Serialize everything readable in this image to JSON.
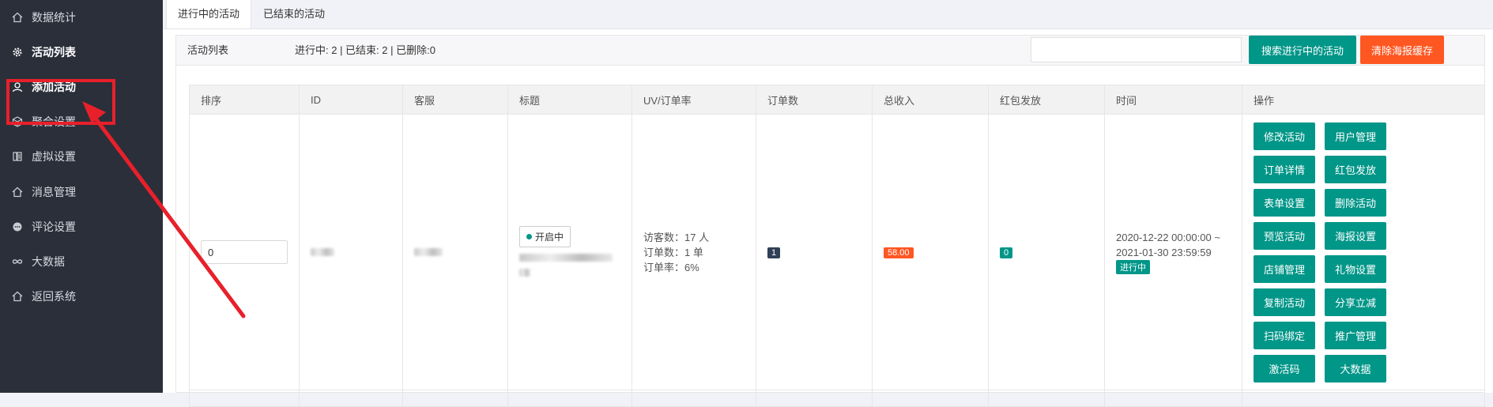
{
  "sidebar": {
    "items": [
      {
        "label": "数据统计",
        "icon": "home-icon"
      },
      {
        "label": "活动列表",
        "icon": "gear-icon"
      },
      {
        "label": "添加活动",
        "icon": "user-icon"
      },
      {
        "label": "聚合设置",
        "icon": "cube-icon"
      },
      {
        "label": "虚拟设置",
        "icon": "book-icon"
      },
      {
        "label": "消息管理",
        "icon": "home-icon"
      },
      {
        "label": "评论设置",
        "icon": "chat-icon"
      },
      {
        "label": "大数据",
        "icon": "infinity-icon"
      },
      {
        "label": "返回系统",
        "icon": "home-icon"
      }
    ]
  },
  "tabs": [
    {
      "label": "进行中的活动"
    },
    {
      "label": "已结束的活动"
    }
  ],
  "panel": {
    "title": "活动列表",
    "stats": "进行中: 2 | 已结束: 2 | 已删除:0",
    "search_button": "搜索进行中的活动",
    "clear_button": "清除海报缓存"
  },
  "table": {
    "headers": [
      "排序",
      "ID",
      "客服",
      "标题",
      "UV/订单率",
      "订单数",
      "总收入",
      "红包发放",
      "时间",
      "操作"
    ],
    "row": {
      "sort_value": "0",
      "status": "开启中",
      "uv": [
        "访客数：17 人",
        "订单数：1 单",
        "订单率：6%"
      ],
      "orders": "1",
      "revenue": "58.00",
      "redpacket": "0",
      "time_start": "2020-12-22 00:00:00 ~",
      "time_end": "2021-01-30 23:59:59",
      "time_status": "进行中",
      "actions": [
        "修改活动",
        "用户管理",
        "订单详情",
        "红包发放",
        "表单设置",
        "删除活动",
        "预览活动",
        "海报设置",
        "店铺管理",
        "礼物设置",
        "复制活动",
        "分享立减",
        "扫码绑定",
        "推广管理",
        "激活码",
        "大数据"
      ]
    }
  },
  "colors": {
    "sidebar_bg": "#2b2f3a",
    "accent": "#009688",
    "warning": "#ff5722",
    "highlight": "#e8202a"
  }
}
